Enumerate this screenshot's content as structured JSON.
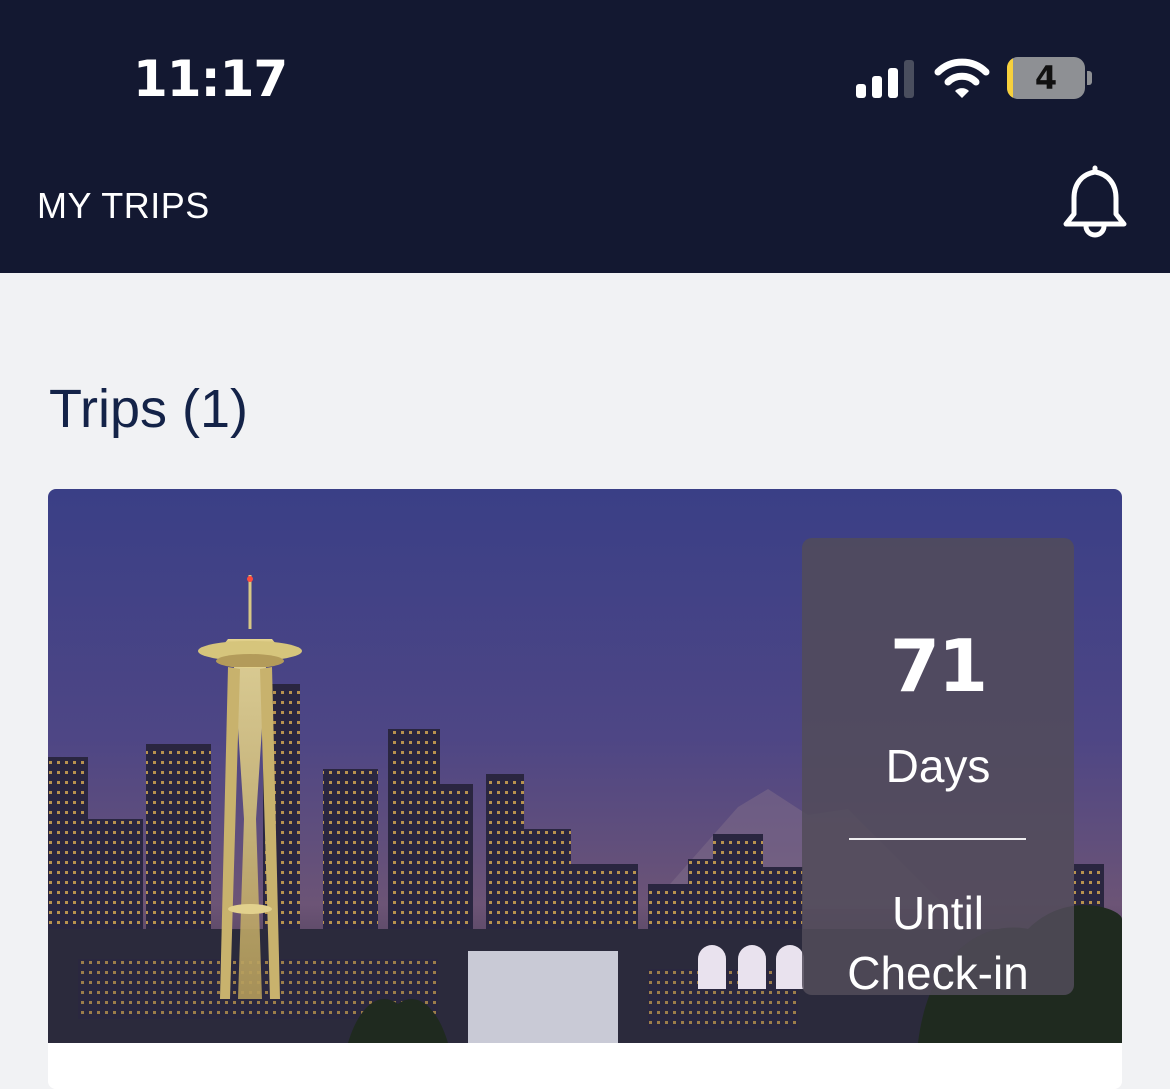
{
  "status_bar": {
    "time": "11:17",
    "battery_level": "4",
    "icons": [
      "cellular-signal-icon",
      "wifi-icon",
      "battery-icon"
    ]
  },
  "header": {
    "title": "MY TRIPS",
    "notification_icon": "bell-icon"
  },
  "trips_section": {
    "title": "Trips (1)"
  },
  "trip_card": {
    "image": "seattle-skyline-at-dusk",
    "countdown": {
      "value": "71",
      "unit": "Days",
      "caption_line1": "Until",
      "caption_line2": "Check-in"
    }
  },
  "colors": {
    "header_background": "#131831",
    "page_background": "#f1f2f4",
    "section_title": "#142348",
    "battery_low": "#f7d03c"
  }
}
